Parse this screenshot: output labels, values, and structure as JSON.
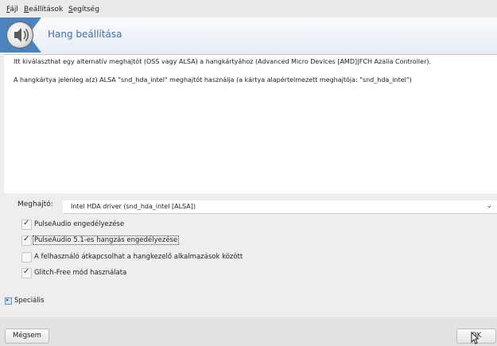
{
  "menubar": {
    "items": [
      {
        "label": "Fájl",
        "mnemonic": "F",
        "rest": "ájl"
      },
      {
        "label": "Beállítások",
        "mnemonic": "B",
        "rest": "eállítások"
      },
      {
        "label": "Segítség",
        "mnemonic": "S",
        "rest": "egítség"
      }
    ]
  },
  "header": {
    "title": "Hang beállítása",
    "icon": "speaker-icon",
    "accent_color": "#4a83bf"
  },
  "info": {
    "line1": "Itt kiválaszthat egy alternatív meghajtót (OSS vagy ALSA) a hangkártyához (Advanced Micro Devices [AMD]|FCH Azalia Controller).",
    "line2": "A hangkártya jelenleg a(z) ALSA \"snd_hda_intel\" meghajtót használja (a kártya alapértelmezett meghajtója: \"snd_hda_intel\")"
  },
  "driver": {
    "label": "Meghajtó:",
    "selected": "Intel HDA driver (snd_hda_intel [ALSA])"
  },
  "options": [
    {
      "label": "PulseAudio engedélyezése",
      "checked": true
    },
    {
      "label": "PulseAudio 5.1-es hangzás engedélyezése",
      "checked": true
    },
    {
      "label": "A felhasználó átkapcsolhat a hangkezelő alkalmazások között",
      "checked": false
    },
    {
      "label": "Glitch-Free mód használata",
      "checked": true
    }
  ],
  "advanced": {
    "label": "Speciális",
    "icon": "expander-icon"
  },
  "buttons": {
    "cancel": "Mégsem",
    "ok": "OK",
    "ok_mnemonic": "O",
    "ok_rest": "K"
  }
}
